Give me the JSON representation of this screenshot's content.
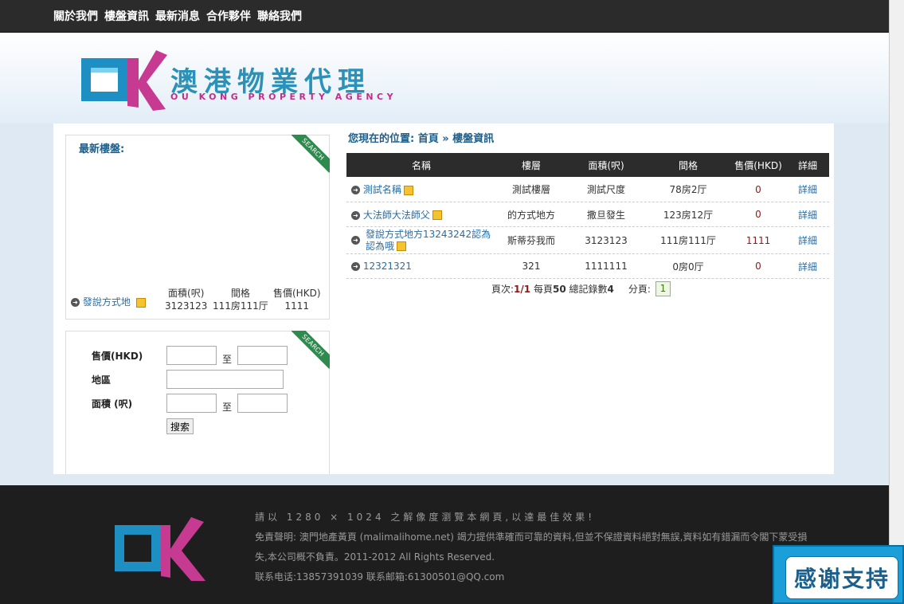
{
  "nav": [
    "關於我們",
    "樓盤資訊",
    "最新消息",
    "合作夥伴",
    "聯絡我們"
  ],
  "logo": {
    "title": "澳港物業代理",
    "subtitle": "OU KONG PROPERTY AGENCY"
  },
  "latest": {
    "title": "最新樓盤:",
    "ribbon": "SEARCH",
    "item": {
      "name": "發說方式地",
      "area_label": "面積(呎)",
      "area": "3123123",
      "layout_label": "間格",
      "layout": "111房111厅",
      "price_label": "售價(HKD)",
      "price": "1111"
    }
  },
  "search": {
    "ribbon": "SEARCH",
    "price_label": "售價(HKD)",
    "region_label": "地區",
    "area_label": "面積 (呎)",
    "to": "至",
    "button": "搜索"
  },
  "breadcrumb": "您現在的位置: 首頁 » 樓盤資訊",
  "table": {
    "headers": [
      "名稱",
      "樓層",
      "面積(呎)",
      "間格",
      "售價(HKD)",
      "詳細"
    ],
    "rows": [
      {
        "name": "測試名稱",
        "floor": "測試樓層",
        "area": "測試尺度",
        "layout": "78房2厅",
        "price": "0",
        "detail": "詳細"
      },
      {
        "name": "大法師大法師父",
        "floor": "的方式地方",
        "area": "撒旦發生",
        "layout": "123房12厅",
        "price": "0",
        "detail": "詳細"
      },
      {
        "name": "發說方式地方13243242認為認為哦",
        "floor": "斯蒂芬我而",
        "area": "3123123",
        "layout": "111房111厅",
        "price": "1111",
        "detail": "詳細"
      },
      {
        "name": "12321321",
        "floor": "321",
        "area": "1111111",
        "layout": "0房0厅",
        "price": "0",
        "detail": "詳細"
      }
    ]
  },
  "pager": {
    "label": "頁次:",
    "current": "1/1",
    "per_page_label": "每頁",
    "per_page": "50",
    "total_label": "總記錄數",
    "total": "4",
    "pages_label": "分頁:",
    "page": "1"
  },
  "footer": {
    "note": "請以 1280 × 1024 之解像度瀏覽本網頁,以達最佳效果!",
    "disclaimer1": "免責聲明: 澳門地產黃頁 (malimalihome.net) 竭力提供準確而可靠的資料,但並不保證資料絕對無誤,資料如有錯漏而令閣下蒙受損",
    "disclaimer2": "失,本公司概不負責。2011-2012 All Rights Reserved.",
    "contact": "联系电话:13857391039 联系邮箱:61300501@QQ.com"
  },
  "thanks": "感谢支持",
  "colors": {
    "accent": "#1b5f8c",
    "nav_bg": "#2b2b2b",
    "logo_pink": "#c0308a",
    "logo_blue": "#2a92b8"
  }
}
